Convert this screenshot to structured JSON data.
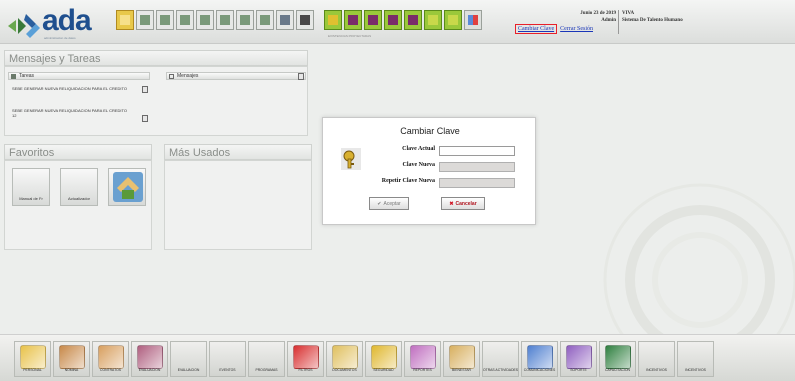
{
  "logo": {
    "text": "ada",
    "tagline": "administracion de datos"
  },
  "header": {
    "date": "Junio 23 de 2019",
    "user": "Admin",
    "company_short": "VIVA",
    "company_name": "Sistema De Talento Humano",
    "toolbar_caption": "EXISTENCIAS PROYECTADAS",
    "links": {
      "change_password": "Cambiar Clave",
      "logout": "Cerrar Sesión"
    }
  },
  "toolbar": {
    "icons": [
      "folder-icon",
      "doc-icon",
      "doc-icon",
      "doc-icon",
      "doc-icon",
      "doc-icon",
      "doc-icon",
      "doc-icon",
      "doc-icon",
      "table-icon",
      "green-icon",
      "green-icon",
      "green-icon",
      "green-icon",
      "green-icon",
      "green-icon",
      "grid-icon"
    ]
  },
  "panels": {
    "messages_title": "Mensajes y Tareas",
    "tasks_label": "Tareas",
    "messages_label": "Mensajes",
    "tasks": [
      "SEBE GENERAR NUEVA RELIQUIDACION PARA EL CREDITO",
      "SEBE GENERAR NUEVA RELIQUIDACION PARA EL CREDITO 12"
    ],
    "favorites_title": "Favoritos",
    "most_used_title": "Más Usados",
    "favorites": [
      {
        "label": "Manual de Fr",
        "icon": "manual-icon"
      },
      {
        "label": "Actualizador",
        "icon": "update-icon"
      },
      {
        "label": "",
        "icon": "home-icon"
      }
    ]
  },
  "dialog": {
    "title": "Cambiar Clave",
    "current_label": "Clave Actual",
    "new_label": "Clave Nueva",
    "repeat_label": "Repetir Clave Nueva",
    "current_value": "",
    "new_value": "",
    "repeat_value": "",
    "accept_label": "Aceptar",
    "cancel_label": "Cancelar"
  },
  "dock": [
    {
      "label": "Personal",
      "icon": "people-icon",
      "color": "#e8c24a"
    },
    {
      "label": "Nomina",
      "icon": "people-icon",
      "color": "#c88a4a"
    },
    {
      "label": "Contratos",
      "icon": "doc-icon",
      "color": "#d8a060"
    },
    {
      "label": "Evaluacion",
      "icon": "people-icon",
      "color": "#b06080"
    },
    {
      "label": "Evaluacion",
      "icon": "blank-icon",
      "color": ""
    },
    {
      "label": "Eventos",
      "icon": "blank-icon",
      "color": ""
    },
    {
      "label": "Programas",
      "icon": "blank-icon",
      "color": ""
    },
    {
      "label": "Filtros",
      "icon": "filter-icon",
      "color": "#d83030"
    },
    {
      "label": "Documentos",
      "icon": "envelope-icon",
      "color": "#e0c060"
    },
    {
      "label": "Seguridad",
      "icon": "key-icon",
      "color": "#e0b830"
    },
    {
      "label": "Reportes",
      "icon": "pencil-icon",
      "color": "#c070c0"
    },
    {
      "label": "Bienestar",
      "icon": "tools-icon",
      "color": "#d8b060"
    },
    {
      "label": "Otras Actividades",
      "icon": "blank-icon",
      "color": ""
    },
    {
      "label": "Comunicaciones",
      "icon": "chat-icon",
      "color": "#5080d0"
    },
    {
      "label": "Soporte",
      "icon": "headset-icon",
      "color": "#9060c0"
    },
    {
      "label": "Capacitacion",
      "icon": "graduation-icon",
      "color": "#308040"
    },
    {
      "label": "Incentivos",
      "icon": "blank-icon",
      "color": ""
    },
    {
      "label": "Incentivos",
      "icon": "blank-icon",
      "color": ""
    }
  ],
  "colors": {
    "accent": "#1f4f8e",
    "link": "#1a36b8",
    "highlight_border": "#e8202a",
    "cancel": "#b0141e"
  }
}
